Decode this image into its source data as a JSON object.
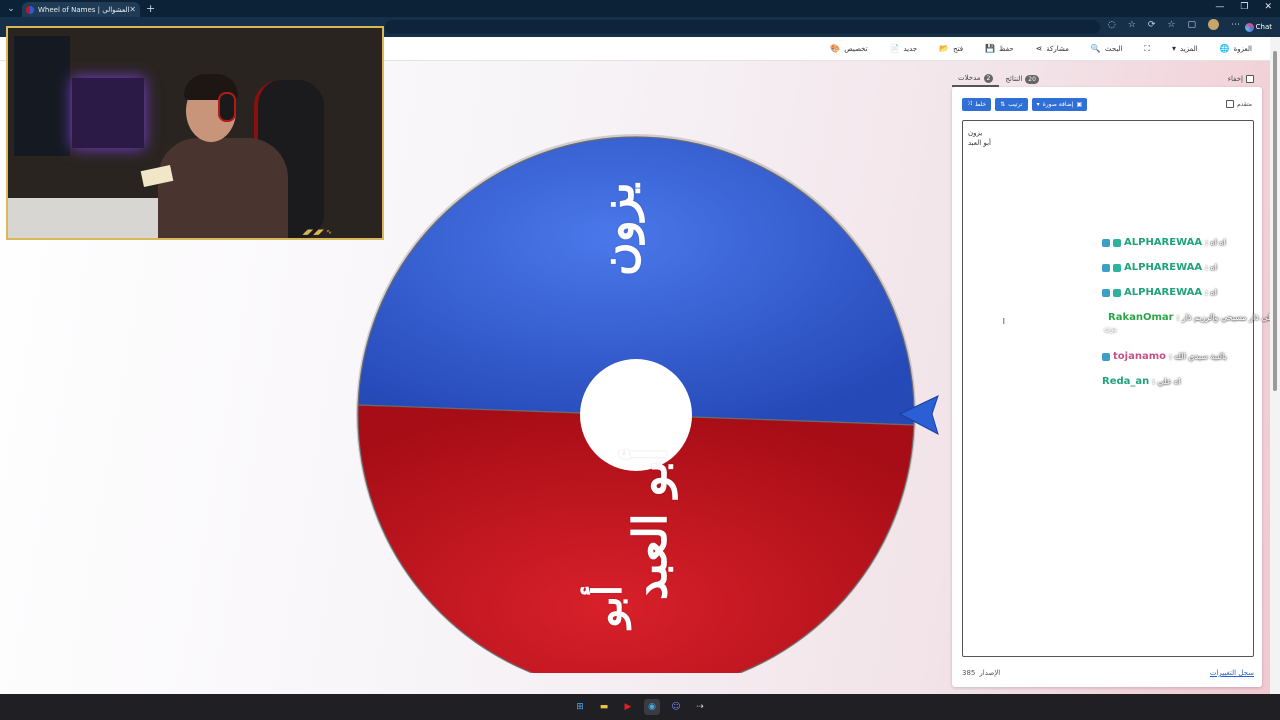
{
  "browser": {
    "tab_title": "Wheel of Names | ناصر العشوالي",
    "tab_close": "✕",
    "new_tab": "+",
    "menu_glyph": "⌄",
    "window_controls": [
      "—",
      "❐",
      "✕"
    ],
    "chat_label": "Chat"
  },
  "toolbar": {
    "items": [
      {
        "label": "العزوة",
        "icon": "🌐"
      },
      {
        "label": "المزيد",
        "icon": "▾"
      },
      {
        "label": "",
        "icon": "⛶"
      },
      {
        "label": "البحث",
        "icon": "🔍"
      },
      {
        "label": "مشاركة",
        "icon": "⋖"
      },
      {
        "label": "حفظ",
        "icon": "💾"
      },
      {
        "label": "فتح",
        "icon": "📂"
      },
      {
        "label": "جديد",
        "icon": "📄"
      },
      {
        "label": "تخصيص",
        "icon": "🎨"
      }
    ]
  },
  "wheel": {
    "segments": [
      {
        "label": "يزون",
        "color": "#2f5ed8"
      },
      {
        "label": "أبو العبد",
        "color": "#c8141e"
      }
    ],
    "label_top": "يزون",
    "label_mid": "أبو العبد",
    "label_low": "أبو",
    "pointer_color": "#2a5fd6",
    "center_color": "#ffffff"
  },
  "panel": {
    "tabs": [
      {
        "label": "مدخلات",
        "count": "2"
      },
      {
        "label": "النتائج",
        "count": "20"
      }
    ],
    "hide_label": "إخفاء",
    "actions": {
      "shuffle": "خلط",
      "sort": "ترتيب",
      "add_image": "إضافة صورة",
      "advanced": "متقدم"
    },
    "entries": [
      "يزون",
      "أبو العبد"
    ],
    "caret": "I",
    "footer": {
      "count_label": "الإصدار",
      "count_value": "385",
      "version_link": "سجل التغييرات"
    }
  },
  "chat_overlay": {
    "messages": [
      {
        "user": "ALPHAREWAA",
        "msg": ": اه اه",
        "user_color": "#1fa37a",
        "badges": [
          "#3aa0c8",
          "#2bb3a0"
        ]
      },
      {
        "user": "ALPHAREWAA",
        "msg": ": اه",
        "user_color": "#1fa37a",
        "badges": [
          "#3aa0c8",
          "#2bb3a0"
        ]
      },
      {
        "user": "ALPHAREWAA",
        "msg": ": اه",
        "user_color": "#1fa37a",
        "badges": [
          "#3aa0c8",
          "#2bb3a0"
        ]
      },
      {
        "user": "RakanOmar",
        "msg": ": على ذار مسيحي والرزيم ذار",
        "user_color": "#2aa54a",
        "badges": [
          "#3aa0c8",
          "#c89a2a"
        ]
      },
      {
        "user": "tojanamo",
        "msg": ": بالنية سيدي الله",
        "user_color": "#c8508a",
        "badges": [
          "#3aa0c8"
        ]
      },
      {
        "user": "Reda_an",
        "msg": ": اه علي",
        "user_color": "#1fa37a",
        "badges": []
      }
    ],
    "continuation": "يزن"
  },
  "webcam": {
    "stamp": "◢◤◢◤ ∿"
  },
  "taskbar": {
    "icons": [
      {
        "name": "windows-start-icon",
        "glyph": "⊞"
      },
      {
        "name": "file-explorer-icon",
        "glyph": "▬"
      },
      {
        "name": "youtube-icon",
        "glyph": "▶"
      },
      {
        "name": "browser-icon",
        "glyph": "◉"
      },
      {
        "name": "discord-icon",
        "glyph": "☺"
      },
      {
        "name": "app-icon",
        "glyph": "⇢"
      }
    ]
  }
}
